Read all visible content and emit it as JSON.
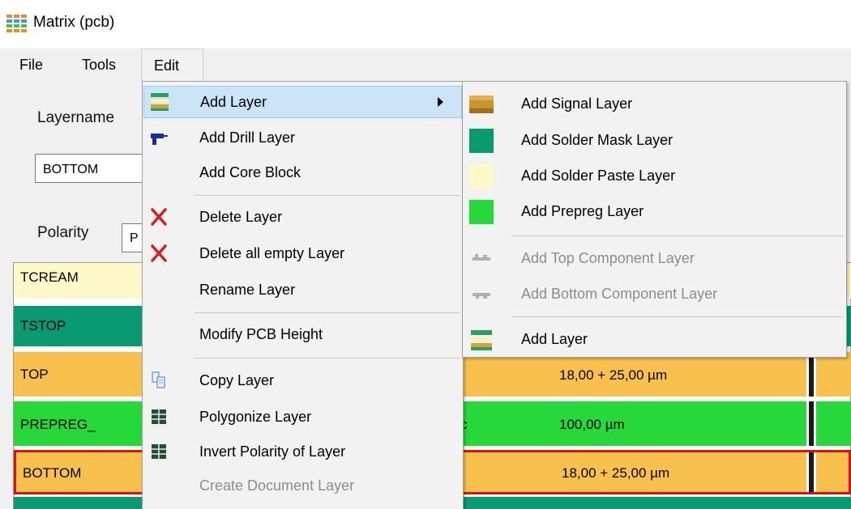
{
  "window": {
    "title": "Matrix (pcb)"
  },
  "menubar": {
    "file": "File",
    "tools": "Tools",
    "edit": "Edit"
  },
  "form": {
    "layername_label": "Layername",
    "layername_value": "BOTTOM",
    "polarity_label": "Polarity",
    "polarity_value": "P"
  },
  "layers": [
    {
      "name": "TCREAM",
      "type": "",
      "thickness": "",
      "color": "#fff8c8"
    },
    {
      "name": "TSTOP",
      "type": "",
      "thickness": "",
      "color": "#0a9a72"
    },
    {
      "name": "TOP",
      "type": "",
      "thickness": "18,00 + 25,00 µm",
      "color": "#f8c04d"
    },
    {
      "name": "PREPREG_",
      "type": "tric",
      "thickness": "100,00 µm",
      "color": "#27d83a"
    },
    {
      "name": "BOTTOM",
      "type": "",
      "thickness": "18,00 + 25,00 µm",
      "color": "#f8c04d"
    }
  ],
  "edit_menu": {
    "items": [
      {
        "label": "Add Layer",
        "icon": "layer-stack-icon",
        "highlighted": true,
        "submenu": true
      },
      {
        "label": "Add Drill Layer",
        "icon": "drill-icon"
      },
      {
        "label": "Add Core Block",
        "icon": ""
      },
      {
        "label": "Delete Layer",
        "icon": "delete-x-icon"
      },
      {
        "label": "Delete all empty Layer",
        "icon": "delete-x-icon"
      },
      {
        "label": "Rename Layer",
        "icon": ""
      },
      {
        "label": "Modify PCB Height",
        "icon": ""
      },
      {
        "label": "Copy Layer",
        "icon": "copy-layer-icon"
      },
      {
        "label": "Polygonize Layer",
        "icon": "grid-icon"
      },
      {
        "label": "Invert Polarity of Layer",
        "icon": "grid-icon"
      },
      {
        "label": "Create Document Layer",
        "icon": "",
        "disabled": true
      }
    ]
  },
  "add_layer_submenu": {
    "items": [
      {
        "label": "Add Signal Layer",
        "icon": "signal-layer-icon",
        "color": "#c8962e"
      },
      {
        "label": "Add Solder Mask Layer",
        "icon": "solder-mask-icon",
        "color": "#0a9a72"
      },
      {
        "label": "Add Solder Paste Layer",
        "icon": "solder-paste-icon",
        "color": "#fff8c8"
      },
      {
        "label": "Add Prepreg Layer",
        "icon": "prepreg-icon",
        "color": "#27d83a"
      },
      {
        "label": "Add Top Component Layer",
        "icon": "top-component-icon",
        "disabled": true
      },
      {
        "label": "Add Bottom Component Layer",
        "icon": "bottom-component-icon",
        "disabled": true
      },
      {
        "label": "Add Layer",
        "icon": "layer-stack-icon"
      }
    ]
  },
  "colors": {
    "highlight": "#cce4f7",
    "highlight_border": "#99c9ef",
    "selected_row_border": "#e01010",
    "window_bg": "#f0f0f0"
  }
}
